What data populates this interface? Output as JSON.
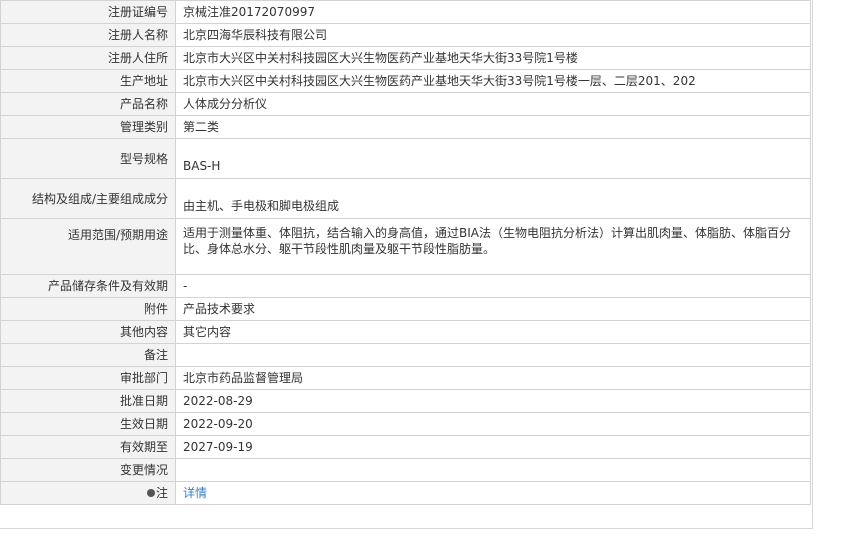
{
  "rows": [
    {
      "label": "注册证编号",
      "value": "京械注准20172070997"
    },
    {
      "label": "注册人名称",
      "value": "北京四海华辰科技有限公司"
    },
    {
      "label": "注册人住所",
      "value": "北京市大兴区中关村科技园区大兴生物医药产业基地天华大街33号院1号楼"
    },
    {
      "label": "生产地址",
      "value": "北京市大兴区中关村科技园区大兴生物医药产业基地天华大街33号院1号楼一层、二层201、202"
    },
    {
      "label": "产品名称",
      "value": "人体成分分析仪"
    },
    {
      "label": "管理类别",
      "value": "第二类"
    },
    {
      "label": "型号规格",
      "value": "BAS-H"
    },
    {
      "label": "结构及组成/主要组成成分",
      "value": "由主机、手电极和脚电极组成"
    },
    {
      "label": "适用范围/预期用途",
      "value": "适用于测量体重、体阻抗，结合输入的身高值，通过BIA法（生物电阻抗分析法）计算出肌肉量、体脂肪、体脂百分比、身体总水分、躯干节段性肌肉量及躯干节段性脂肪量。"
    },
    {
      "label": "产品储存条件及有效期",
      "value": "-"
    },
    {
      "label": "附件",
      "value": "产品技术要求"
    },
    {
      "label": "其他内容",
      "value": "其它内容"
    },
    {
      "label": "备注",
      "value": ""
    },
    {
      "label": "审批部门",
      "value": "北京市药品监督管理局"
    },
    {
      "label": "批准日期",
      "value": "2022-08-29"
    },
    {
      "label": "生效日期",
      "value": "2022-09-20"
    },
    {
      "label": "有效期至",
      "value": "2027-09-19"
    },
    {
      "label": "变更情况",
      "value": ""
    }
  ],
  "note": {
    "label": "注",
    "link_text": "详情",
    "icon": "note-icon"
  }
}
